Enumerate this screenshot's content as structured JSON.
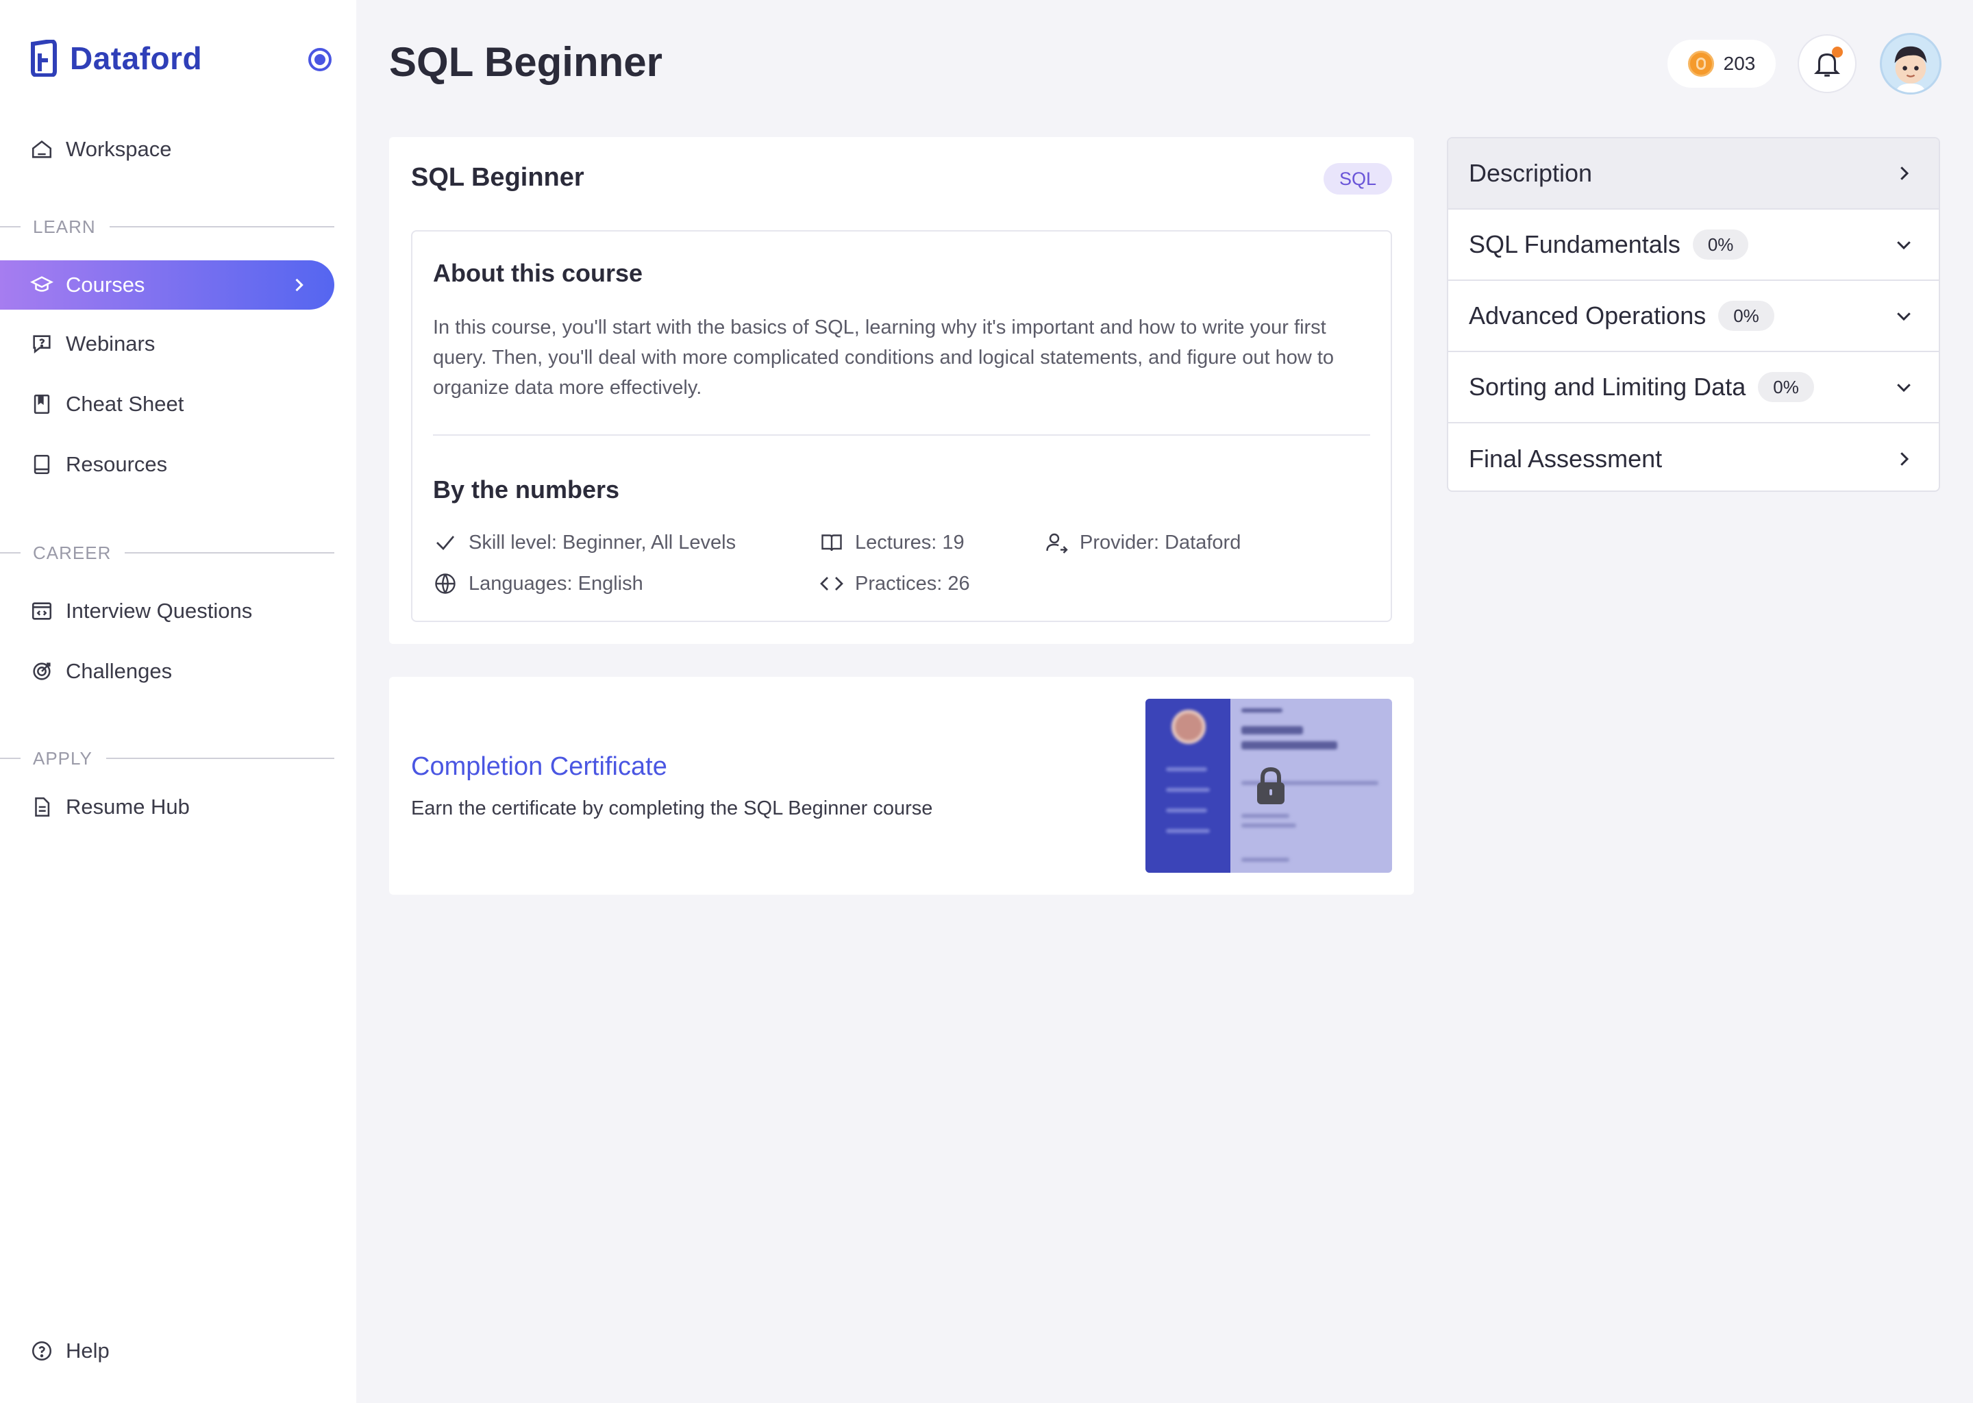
{
  "app": {
    "name": "Dataford"
  },
  "sidebar": {
    "workspace": "Workspace",
    "sections": {
      "learn": "LEARN",
      "career": "CAREER",
      "apply": "APPLY"
    },
    "learn_items": [
      "Courses",
      "Webinars",
      "Cheat Sheet",
      "Resources"
    ],
    "career_items": [
      "Interview Questions",
      "Challenges"
    ],
    "apply_items": [
      "Resume Hub"
    ],
    "help": "Help",
    "active": "Courses"
  },
  "header": {
    "title": "SQL Beginner",
    "coins": "203"
  },
  "course": {
    "name": "SQL Beginner",
    "tag": "SQL",
    "about_title": "About this course",
    "about_text": "In this course, you'll start with the basics of SQL, learning why it's important and how to write your first query. Then, you'll deal with more complicated conditions and logical statements, and figure out how to organize data more effectively.",
    "numbers_title": "By the numbers",
    "stats": {
      "skill": "Skill level: Beginner, All Levels",
      "languages": "Languages: English",
      "lectures": "Lectures: 19",
      "practices": "Practices: 26",
      "provider": "Provider: Dataford"
    }
  },
  "certificate": {
    "title": "Completion Certificate",
    "subtitle": "Earn the certificate by completing the SQL Beginner course",
    "locked": true
  },
  "modules": [
    {
      "label": "Description",
      "progress": null,
      "expand": "chevron-right"
    },
    {
      "label": "SQL Fundamentals",
      "progress": "0%",
      "expand": "chevron-down"
    },
    {
      "label": "Advanced Operations",
      "progress": "0%",
      "expand": "chevron-down"
    },
    {
      "label": "Sorting and Limiting Data",
      "progress": "0%",
      "expand": "chevron-down"
    },
    {
      "label": "Final Assessment",
      "progress": null,
      "expand": "chevron-right"
    }
  ],
  "colors": {
    "brand": "#2f3fb8",
    "accent": "#4a56e2",
    "active_gradient_start": "#a67df0",
    "active_gradient_end": "#5566f0",
    "notification_dot": "#f2812a",
    "coin": "#f59a2c"
  }
}
